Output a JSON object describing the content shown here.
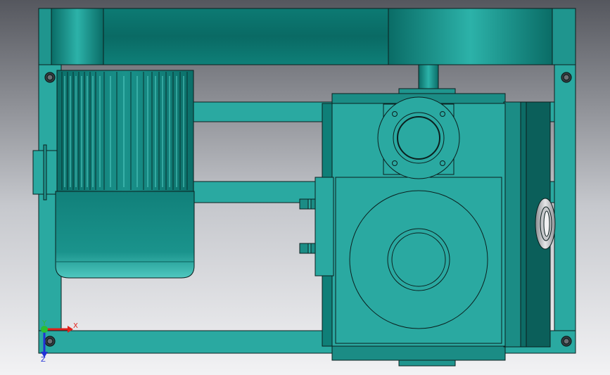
{
  "viewport": {
    "background_gradient": [
      "#5c5e66",
      "#c9cbd0",
      "#f4f4f6"
    ],
    "model_colors": {
      "teal": "#2aa9a1",
      "teal_dark": "#0a6f69",
      "teal_mid": "#1f958e",
      "teal_light": "#55cfc6",
      "outline": "#0b1f1e",
      "steel": "#9c9ea3"
    }
  },
  "triad": {
    "x_label": "X",
    "y_label": "Y",
    "z_label": "Z",
    "x_color": "#e0221b",
    "y_color": "#2bbf31",
    "z_color": "#2231d6"
  }
}
